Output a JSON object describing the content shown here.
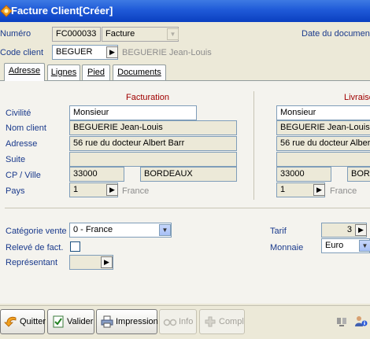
{
  "window": {
    "title": "Facture Client[Créer]"
  },
  "header": {
    "numero_label": "Numéro",
    "numero_value": "FC000033",
    "type_value": "Facture",
    "date_label": "Date du document",
    "code_client_label": "Code client",
    "code_client_value": "BEGUER",
    "client_name": "BEGUERIE Jean-Louis"
  },
  "tabs": [
    {
      "label": "Adresse",
      "active": true
    },
    {
      "label": "Lignes",
      "active": false
    },
    {
      "label": "Pied",
      "active": false
    },
    {
      "label": "Documents",
      "active": false
    }
  ],
  "facturation": {
    "title": "Facturation",
    "civilite_label": "Civilité",
    "civilite_value": "Monsieur",
    "nom_label": "Nom client",
    "nom_value": "BEGUERIE Jean-Louis",
    "adresse_label": "Adresse",
    "adresse_value": "56 rue du docteur Albert Barr",
    "suite_label": "Suite",
    "suite_value": "",
    "cpville_label": "CP / Ville",
    "cp_value": "33000",
    "ville_value": "BORDEAUX",
    "pays_label": "Pays",
    "pays_code": "1",
    "pays_name": "France"
  },
  "livraison": {
    "title": "Livraiso",
    "civilite_value": "Monsieur",
    "nom_value": "BEGUERIE Jean-Louis",
    "adresse_value": "56 rue du docteur Albert",
    "suite_value": "",
    "cp_value": "33000",
    "ville_value": "BORD",
    "pays_code": "1",
    "pays_name": "France"
  },
  "options": {
    "categorie_label": "Catégorie vente",
    "categorie_value": "0 - France",
    "releve_label": "Relevé de fact.",
    "representant_label": "Représentant",
    "representant_value": "",
    "tarif_label": "Tarif",
    "tarif_value": "3",
    "monnaie_label": "Monnaie",
    "monnaie_value": "Euro"
  },
  "toolbar": {
    "quitter": "Quitter",
    "valider": "Valider",
    "impression": "Impression",
    "info": "Info",
    "compl": "Compl"
  },
  "colors": {
    "titlebar": "#0a3fc0",
    "label": "#1a3a8c",
    "section_title": "#a00000"
  }
}
